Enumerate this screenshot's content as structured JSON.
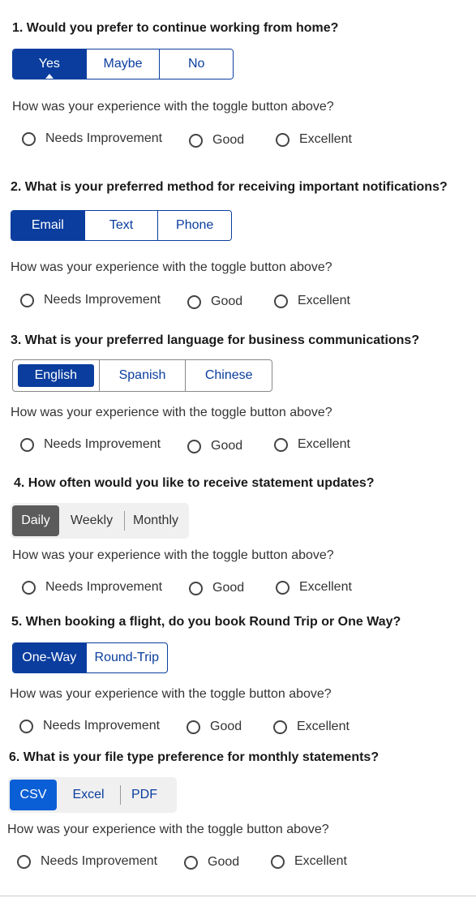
{
  "rating_prompt": "How was your experience with the toggle button above?",
  "rating_options": [
    "Needs Improvement",
    "Good",
    "Excellent"
  ],
  "questions": [
    {
      "title": "1. Would you prefer to continue working from home?",
      "options": [
        "Yes",
        "Maybe",
        "No"
      ],
      "selected": "Yes"
    },
    {
      "title": "2. What is your preferred method for receiving important notifications?",
      "options": [
        "Email",
        "Text",
        "Phone"
      ],
      "selected": "Email"
    },
    {
      "title": "3. What is your preferred language for business communications?",
      "options": [
        "English",
        "Spanish",
        "Chinese"
      ],
      "selected": "English"
    },
    {
      "title": "4. How often would you like to receive statement updates?",
      "options": [
        "Daily",
        "Weekly",
        "Monthly"
      ],
      "selected": "Daily"
    },
    {
      "title": "5. When booking a flight, do you book Round Trip or One Way?",
      "options": [
        "One-Way",
        "Round-Trip"
      ],
      "selected": "One-Way"
    },
    {
      "title": "6. What is your file type preference for monthly statements?",
      "options": [
        "CSV",
        "Excel",
        "PDF"
      ],
      "selected": "CSV"
    }
  ],
  "colors": {
    "primary": "#0a3d9e",
    "gray_selected": "#5b5b5b",
    "csv_selected": "#0b5fd6",
    "gray_bg": "#f0f0f0"
  }
}
